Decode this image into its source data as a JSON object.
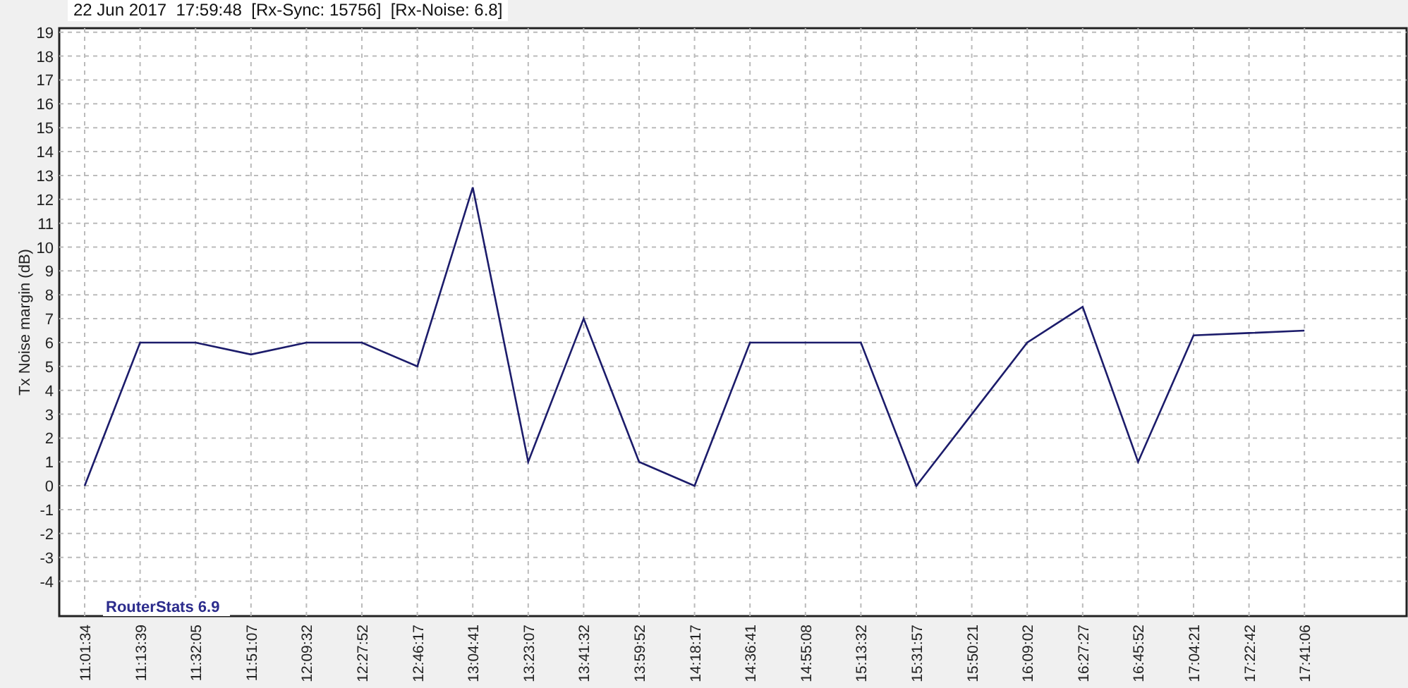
{
  "header": "22 Jun 2017  17:59:48  [Rx-Sync: 15756]  [Rx-Noise: 6.8]",
  "chart": {
    "product_label": "RouterStats 6.9",
    "chart_data": {
      "type": "line",
      "ylabel": "Tx Noise margin (dB)",
      "categories": [
        "11:01:34",
        "11:13:39",
        "11:32:05",
        "11:51:07",
        "12:09:32",
        "12:27:52",
        "12:46:17",
        "13:04:41",
        "13:23:07",
        "13:41:32",
        "13:59:52",
        "14:18:17",
        "14:36:41",
        "14:55:08",
        "15:13:32",
        "15:31:57",
        "15:50:21",
        "16:09:02",
        "16:27:27",
        "16:45:52",
        "17:04:21",
        "17:22:42",
        "17:41:06"
      ],
      "series": [
        {
          "color": "#1c1c6b",
          "values": [
            0,
            6,
            6,
            5.5,
            6,
            6,
            5,
            12.5,
            1,
            7,
            1,
            0,
            6,
            6,
            6,
            0,
            3,
            6,
            7.5,
            1,
            6.3,
            6.4,
            6.5
          ]
        }
      ],
      "ylim": [
        -5.46,
        19.17
      ],
      "grid": true,
      "yticks": [
        -4,
        -3,
        -2,
        -1,
        0,
        1,
        2,
        3,
        4,
        5,
        6,
        7,
        8,
        9,
        10,
        11,
        12,
        13,
        14,
        15,
        16,
        17,
        18,
        19
      ]
    }
  }
}
